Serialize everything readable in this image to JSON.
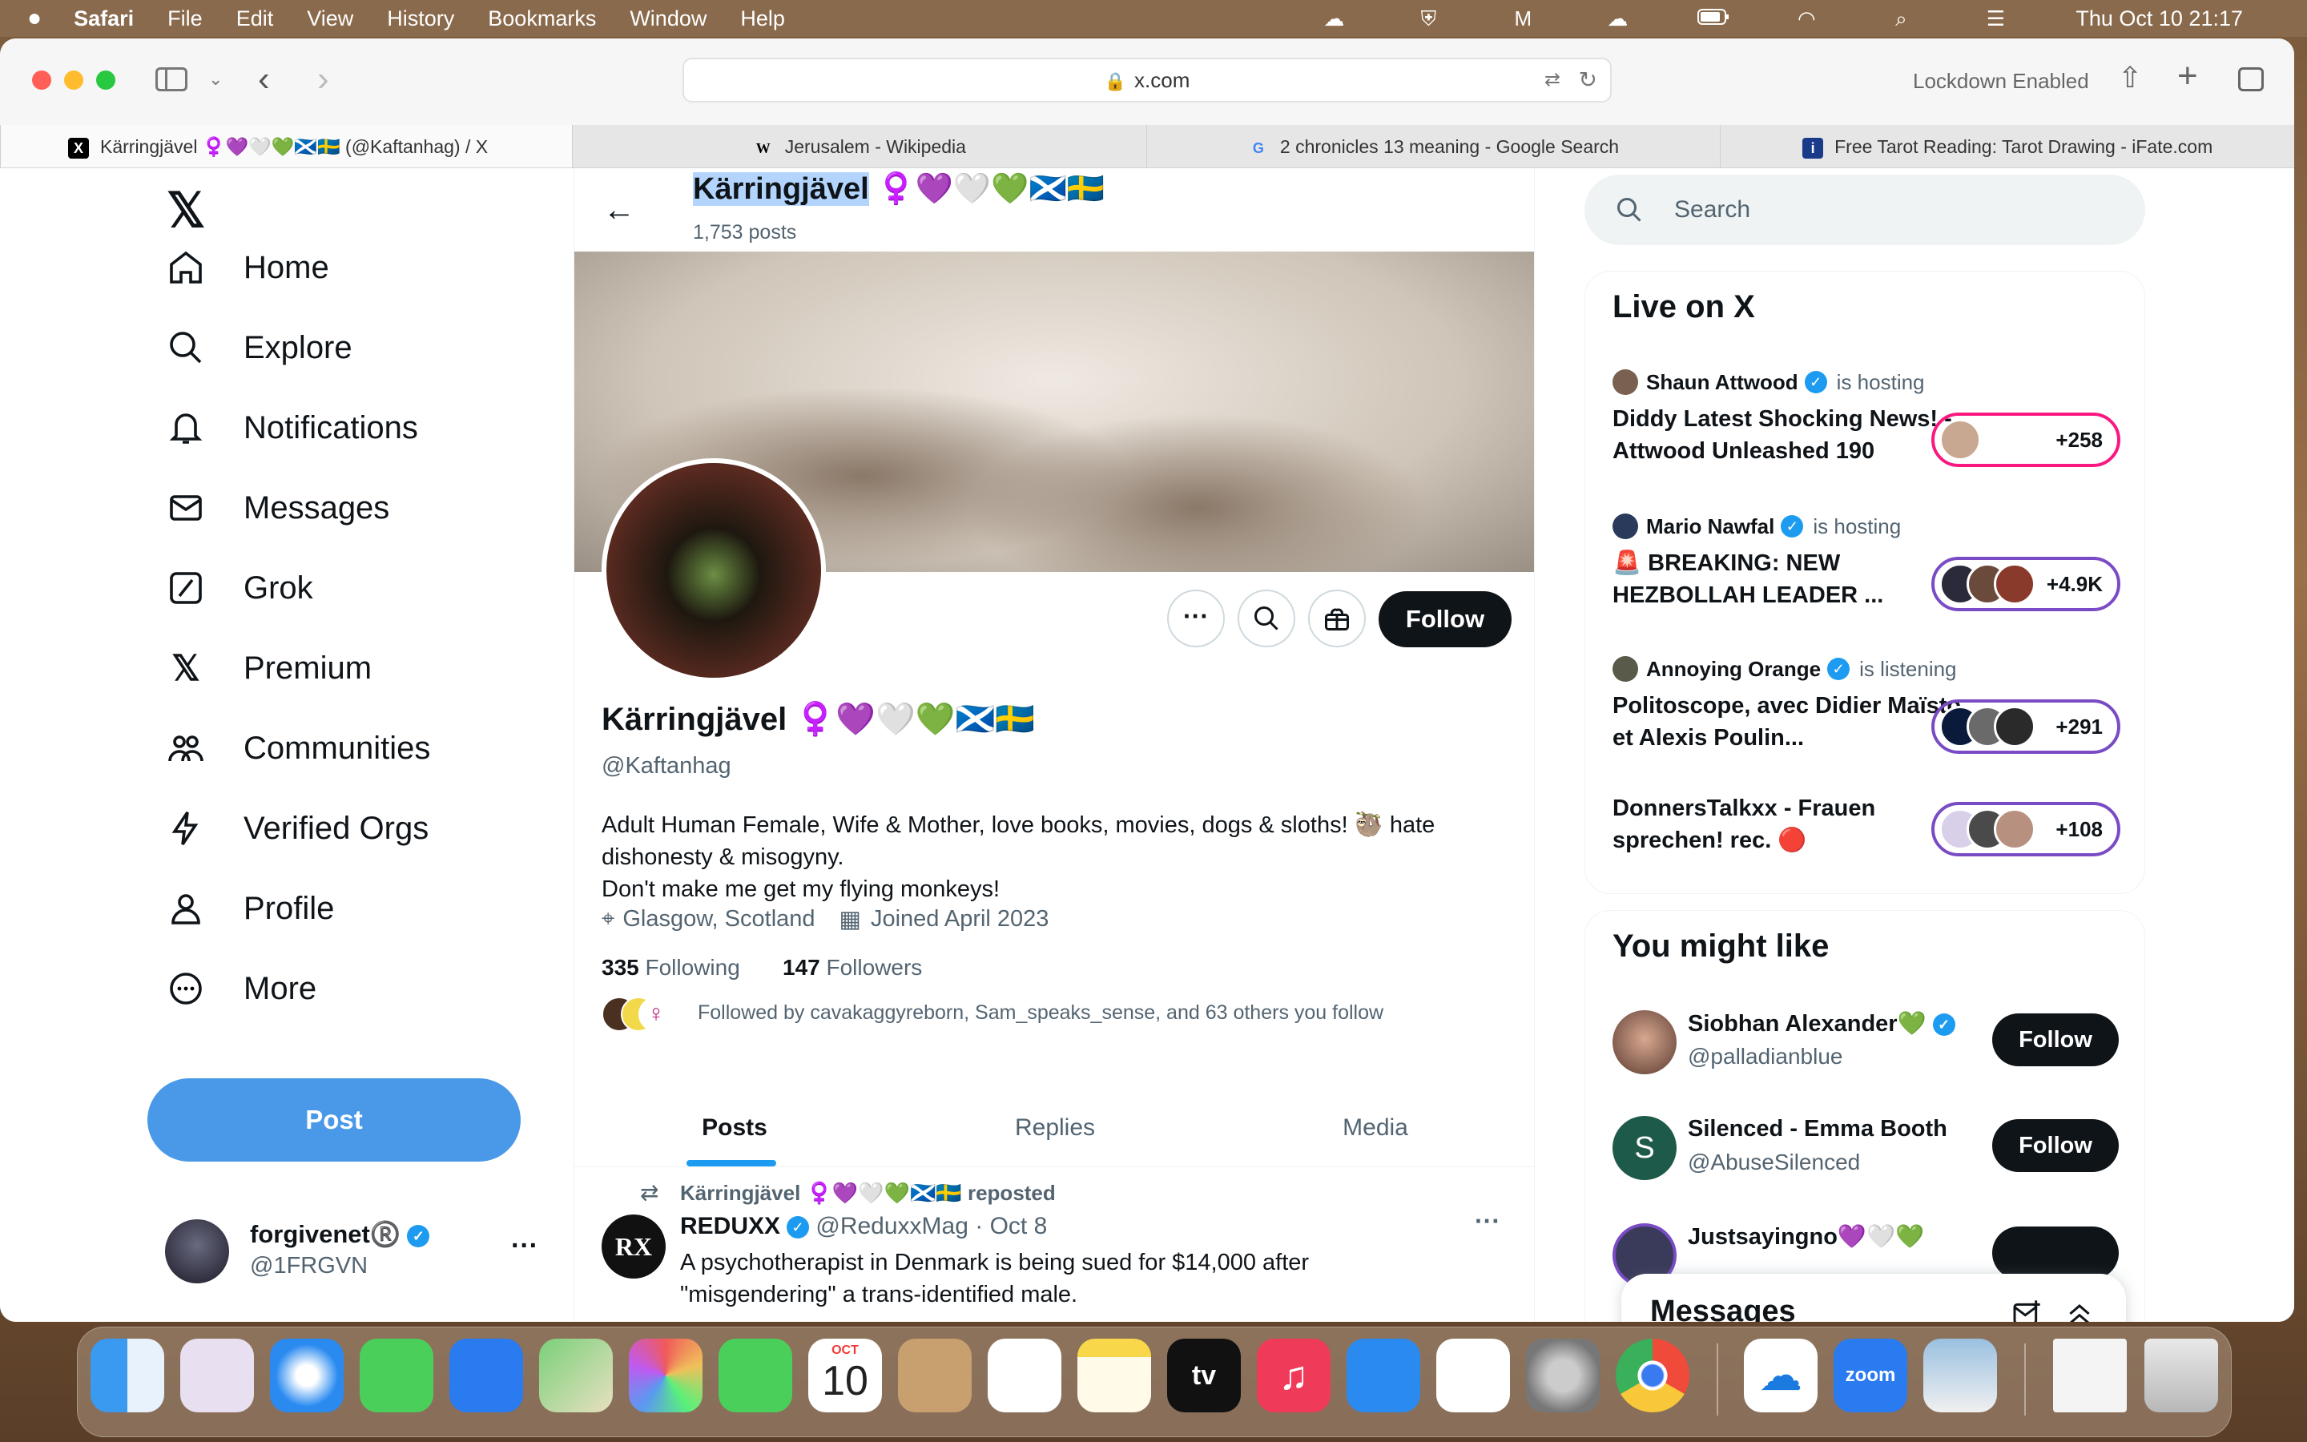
{
  "menubar": {
    "app": "Safari",
    "items": [
      "File",
      "Edit",
      "View",
      "History",
      "Bookmarks",
      "Window",
      "Help"
    ],
    "clock": "Thu Oct 10  21:17"
  },
  "browser": {
    "url": "x.com",
    "lockdown": "Lockdown Enabled",
    "tabs": [
      "Kärringjävel ♀️💜🤍💚🏴󠁧󠁢󠁳󠁣󠁴󠁿🇸🇪 (@Kaftanhag) / X",
      "Jerusalem - Wikipedia",
      "2 chronicles 13 meaning - Google Search",
      "Free Tarot Reading: Tarot Drawing - iFate.com"
    ]
  },
  "nav": {
    "items": [
      "Home",
      "Explore",
      "Notifications",
      "Messages",
      "Grok",
      "Premium",
      "Communities",
      "Verified Orgs",
      "Profile",
      "More"
    ],
    "post": "Post",
    "account": {
      "name": "forgivenet®️",
      "handle": "@1FRGVN"
    }
  },
  "header": {
    "name": "Kärringjävel",
    "emojis": "♀️💜🤍💚🏴󠁧󠁢󠁳󠁣󠁴󠁿🇸🇪",
    "posts": "1,753 posts"
  },
  "profile": {
    "name": "Kärringjävel",
    "emojis": "♀️💜🤍💚🏴󠁧󠁢󠁳󠁣󠁴󠁿🇸🇪",
    "handle": "@Kaftanhag",
    "bio1": "Adult Human Female, Wife & Mother, love books, movies, dogs & sloths! 🦥 hate",
    "bio2": "dishonesty & misogyny.",
    "bio3": "Don't make me get my flying monkeys!",
    "location": "Glasgow, Scotland",
    "joined": "Joined April 2023",
    "following_count": "335",
    "following_label": "Following",
    "followers_count": "147",
    "followers_label": "Followers",
    "followed_by": "Followed by cavakaggyreborn, Sam_speaks_sense, and 63 others you follow",
    "follow": "Follow"
  },
  "tabs": [
    "Posts",
    "Replies",
    "Media"
  ],
  "post": {
    "repost": "Kärringjävel ♀️💜🤍💚🏴󠁧󠁢󠁳󠁣󠁴󠁿🇸🇪 reposted",
    "author": "REDUXX",
    "handle": "@ReduxxMag · Oct 8",
    "line1": "A psychotherapist in Denmark is being sued for $14,000 after",
    "line2": "\"misgendering\" a trans-identified male."
  },
  "search": {
    "placeholder": "Search"
  },
  "live": {
    "title": "Live on X",
    "items": [
      {
        "host": "Shaun Attwood",
        "status": "is hosting",
        "title": "Diddy Latest Shocking News! - Attwood Unleashed 190",
        "count": "+258"
      },
      {
        "host": "Mario Nawfal",
        "status": "is hosting",
        "title": "🚨 BREAKING: NEW HEZBOLLAH LEADER ...",
        "count": "+4.9K"
      },
      {
        "host": "Annoying Orange",
        "status": "is listening",
        "title": "Politoscope, avec Didier Maïsto et Alexis Poulin...",
        "count": "+291"
      },
      {
        "host": "",
        "status": "",
        "title": "DonnersTalkxx - Frauen sprechen!  rec. 🔴",
        "count": "+108"
      }
    ]
  },
  "suggest": {
    "title": "You might like",
    "users": [
      {
        "name": "Siobhan Alexander💚",
        "handle": "@palladianblue",
        "btn": "Follow"
      },
      {
        "name": "Silenced - Emma Booth",
        "handle": "@AbuseSilenced",
        "btn": "Follow",
        "initial": "S"
      },
      {
        "name": "Justsayingno💜🤍💚",
        "handle": "",
        "btn": ""
      }
    ]
  },
  "messages": {
    "title": "Messages"
  },
  "dock": {
    "calendar_month": "OCT",
    "calendar_day": "10",
    "zoom": "zoom",
    "tv": "tv"
  },
  "colors": {
    "accent": "#1d9bf0",
    "post_button": "#4a99e9",
    "live_border": "#794bc4",
    "text": "#0f1419",
    "muted": "#536471"
  }
}
